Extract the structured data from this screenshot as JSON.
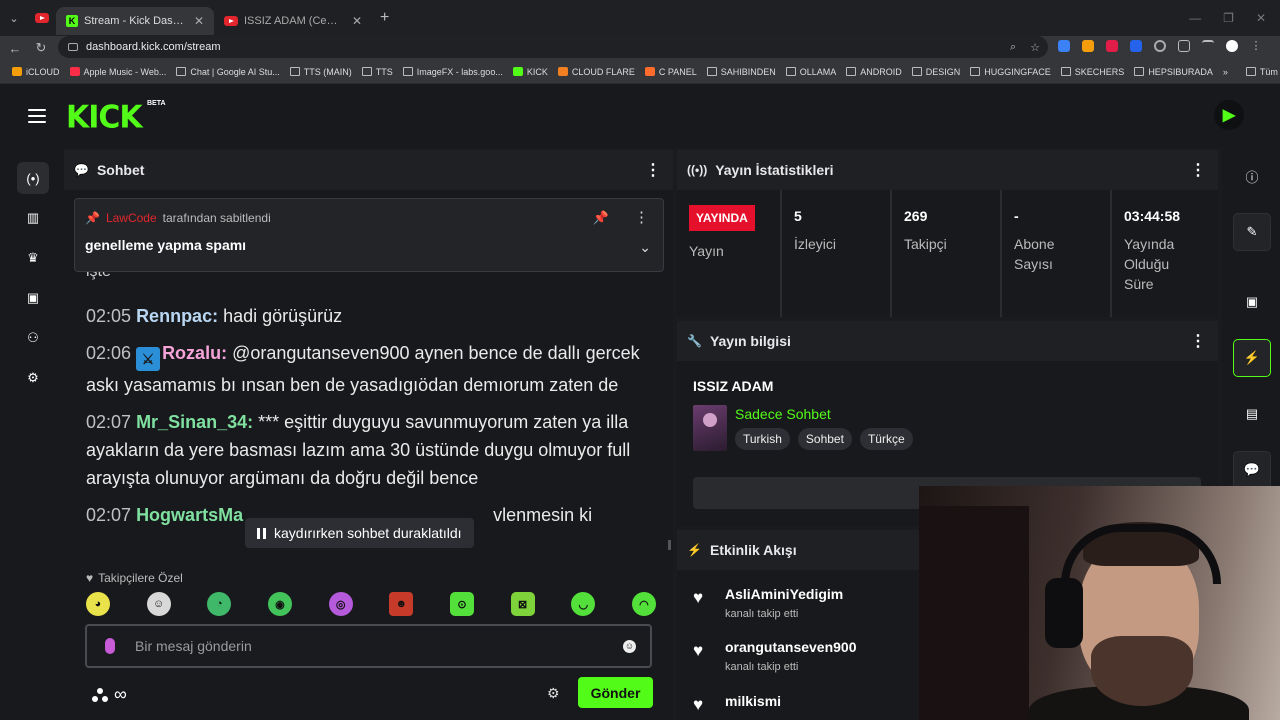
{
  "browser": {
    "tabs": [
      {
        "title": "Stream - Kick Dashboard",
        "active": true
      },
      {
        "title": "ISSIZ ADAM (Cemal Hünal, Mel...",
        "active": false
      }
    ],
    "url": "dashboard.kick.com/stream",
    "bookmarks": [
      {
        "label": "iCLOUD"
      },
      {
        "label": "Apple Music - Web..."
      },
      {
        "label": "Chat | Google AI Stu..."
      },
      {
        "label": "TTS (MAIN)"
      },
      {
        "label": "TTS"
      },
      {
        "label": "ImageFX - labs.goo..."
      },
      {
        "label": "KICK"
      },
      {
        "label": "CLOUD FLARE"
      },
      {
        "label": "C PANEL"
      },
      {
        "label": "SAHIBINDEN"
      },
      {
        "label": "OLLAMA"
      },
      {
        "label": "ANDROID"
      },
      {
        "label": "DESIGN"
      },
      {
        "label": "HUGGINGFACE"
      },
      {
        "label": "SKECHERS"
      },
      {
        "label": "HEPSIBURADA"
      }
    ],
    "bookmarks_overflow": "»",
    "all_bookmarks": "Tüm Yer İşaretleri"
  },
  "header": {
    "logo": "KICK",
    "beta": "BETA"
  },
  "chat": {
    "title": "Sohbet",
    "pinned": {
      "author": "LawCode",
      "suffix": "tarafından sabitlendi",
      "message": "genelleme yapma spamı"
    },
    "cut_line": "işte",
    "messages": [
      {
        "time": "02:05",
        "user": "Rennpac",
        "color": "#b9d6f2",
        "text": "hadi görüşürüz"
      },
      {
        "time": "02:06",
        "user": "Rozalu",
        "color": "#f5a3d8",
        "badge": true,
        "text": "@orangutanseven900 aynen bence de dallı gercek askı yasamamıs bı ınsan ben de yasadıgıödan demıorum zaten de"
      },
      {
        "time": "02:07",
        "user": "Mr_Sinan_34",
        "color": "#7fe0a0",
        "text": "*** eşittir duyguyu savunmuyorum zaten ya illa ayakların da yere basması lazım ama 30 üstünde duygu olmuyor full arayışta olunuyor argümanı da doğru değil bence"
      },
      {
        "time": "02:07",
        "user": "HogwartsMa",
        "color": "#7fe0a0",
        "text": "vlenmesin ki"
      }
    ],
    "paused_notice": "kaydırırken sohbet duraklatıldı",
    "followers_only": "Takipçilere Özel",
    "emotes": [
      "#e9e24a",
      "#d8d8d8",
      "#3fb86a",
      "#43c45a",
      "#b45adb",
      "#c63a2a",
      "#53e03a",
      "#7fd33a",
      "#53e03a",
      "#53e03a"
    ],
    "input_placeholder": "Bir mesaj gönderin",
    "send_label": "Gönder",
    "foot_symbol": "∞"
  },
  "stats": {
    "title": "Yayın İstatistikleri",
    "live_label": "YAYINDA",
    "cells": [
      {
        "value": "",
        "label": "Yayın"
      },
      {
        "value": "5",
        "label": "İzleyici"
      },
      {
        "value": "269",
        "label": "Takipçi"
      },
      {
        "value": "-",
        "label": "Abone Sayısı"
      },
      {
        "value": "03:44:58",
        "label": "Yayında Olduğu Süre"
      }
    ]
  },
  "info": {
    "title": "Yayın bilgisi",
    "stream_title": "ISSIZ ADAM",
    "category": "Sadece Sohbet",
    "tags": [
      "Turkish",
      "Sohbet",
      "Türkçe"
    ]
  },
  "activity": {
    "title": "Etkinlik Akışı",
    "items": [
      {
        "user": "AsliAminiYedigim",
        "action": "kanalı takip etti"
      },
      {
        "user": "orangutanseven900",
        "action": "kanalı takip etti"
      },
      {
        "user": "milkismi",
        "action": ""
      }
    ]
  }
}
